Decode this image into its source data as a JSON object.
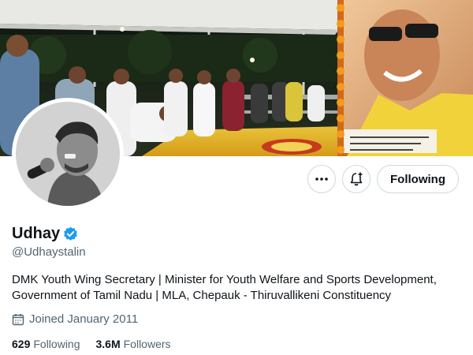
{
  "profile": {
    "display_name": "Udhay",
    "handle": "@Udhaystalin",
    "bio": "DMK Youth Wing Secretary | Minister for Youth Welfare and Sports Development, Government of Tamil Nadu | MLA, Chepauk - Thiruvallikeni Constituency",
    "joined": "Joined January 2011",
    "verified_color": "#1d9bf0"
  },
  "actions": {
    "more_icon": "more-horizontal-icon",
    "notify_icon": "bell-plus-icon",
    "follow_label": "Following"
  },
  "stats": {
    "following_count": "629",
    "following_label": "Following",
    "followers_count": "3.6M",
    "followers_label": "Followers"
  }
}
